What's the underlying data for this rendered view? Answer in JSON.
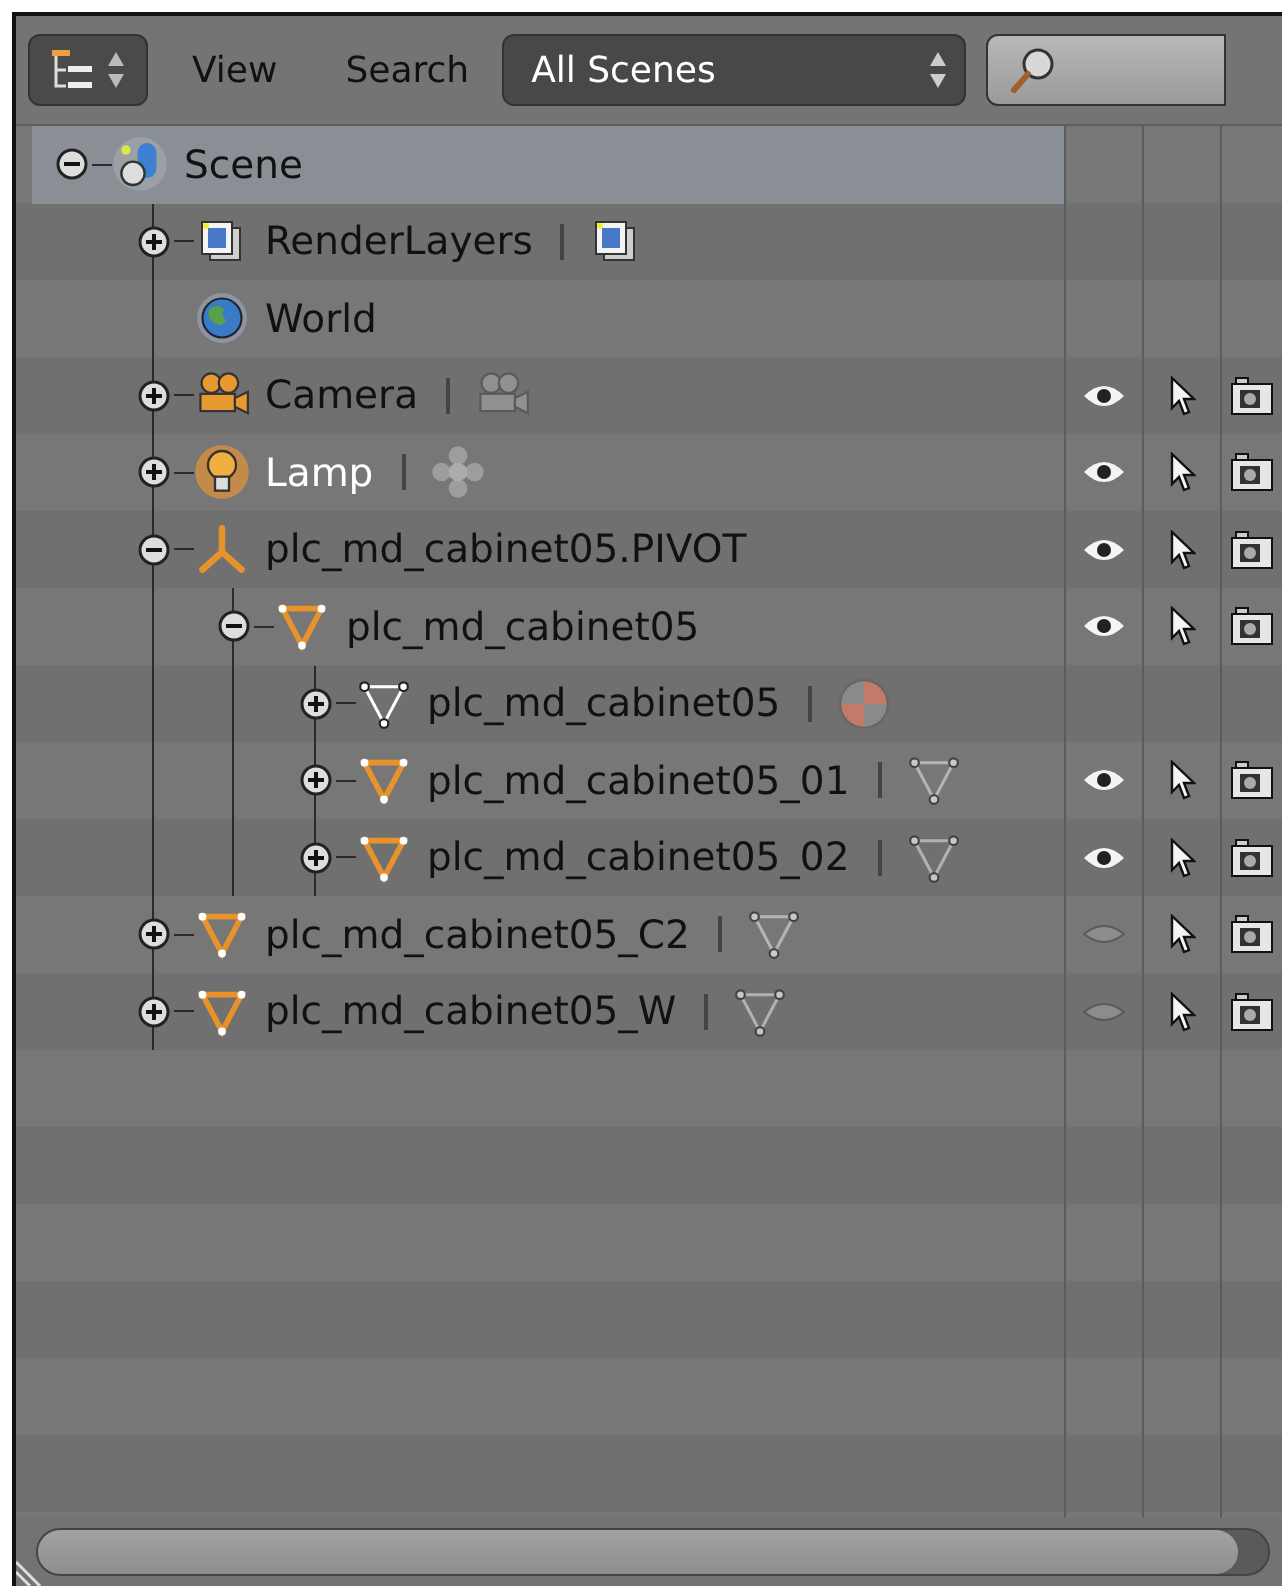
{
  "header": {
    "menus": [
      "View",
      "Search"
    ],
    "scene_filter": "All Scenes"
  },
  "tree": [
    {
      "label": "Scene",
      "kind": "scene",
      "expanded": true,
      "selected": true,
      "active": false,
      "children": [
        {
          "label": "RenderLayers",
          "kind": "renderlayers",
          "expanded": false,
          "selected": false,
          "active": false,
          "data_block": {
            "kind": "renderlayers"
          }
        },
        {
          "label": "World",
          "kind": "world",
          "selected": false,
          "active": false
        },
        {
          "label": "Camera",
          "kind": "camera",
          "expanded": false,
          "selected": false,
          "active": false,
          "data_block": {
            "kind": "camera"
          },
          "restrict": {
            "visible": true,
            "selectable": true,
            "renderable": true
          }
        },
        {
          "label": "Lamp",
          "kind": "lamp",
          "expanded": false,
          "selected": false,
          "active": true,
          "data_block": {
            "kind": "lamp"
          },
          "restrict": {
            "visible": true,
            "selectable": true,
            "renderable": true
          }
        },
        {
          "label": "plc_md_cabinet05.PIVOT",
          "kind": "empty",
          "expanded": true,
          "selected": false,
          "active": false,
          "restrict": {
            "visible": true,
            "selectable": true,
            "renderable": true
          },
          "children": [
            {
              "label": "plc_md_cabinet05",
              "kind": "mesh",
              "expanded": true,
              "selected": false,
              "active": false,
              "restrict": {
                "visible": true,
                "selectable": true,
                "renderable": true
              },
              "children": [
                {
                  "label": "plc_md_cabinet05",
                  "kind": "meshdata",
                  "expanded": false,
                  "selected": false,
                  "active": false,
                  "data_block": {
                    "kind": "material"
                  }
                },
                {
                  "label": "plc_md_cabinet05_01",
                  "kind": "mesh",
                  "expanded": false,
                  "selected": false,
                  "active": false,
                  "data_block": {
                    "kind": "meshdata"
                  },
                  "restrict": {
                    "visible": true,
                    "selectable": true,
                    "renderable": true
                  }
                },
                {
                  "label": "plc_md_cabinet05_02",
                  "kind": "mesh",
                  "expanded": false,
                  "selected": false,
                  "active": false,
                  "data_block": {
                    "kind": "meshdata"
                  },
                  "restrict": {
                    "visible": true,
                    "selectable": true,
                    "renderable": true
                  }
                }
              ]
            }
          ]
        },
        {
          "label": "plc_md_cabinet05_C2",
          "kind": "mesh",
          "expanded": false,
          "selected": false,
          "active": false,
          "data_block": {
            "kind": "meshdata"
          },
          "restrict": {
            "visible": false,
            "selectable": true,
            "renderable": true
          }
        },
        {
          "label": "plc_md_cabinet05_W",
          "kind": "mesh",
          "expanded": false,
          "selected": false,
          "active": false,
          "data_block": {
            "kind": "meshdata"
          },
          "restrict": {
            "visible": false,
            "selectable": true,
            "renderable": true
          }
        }
      ]
    }
  ]
}
